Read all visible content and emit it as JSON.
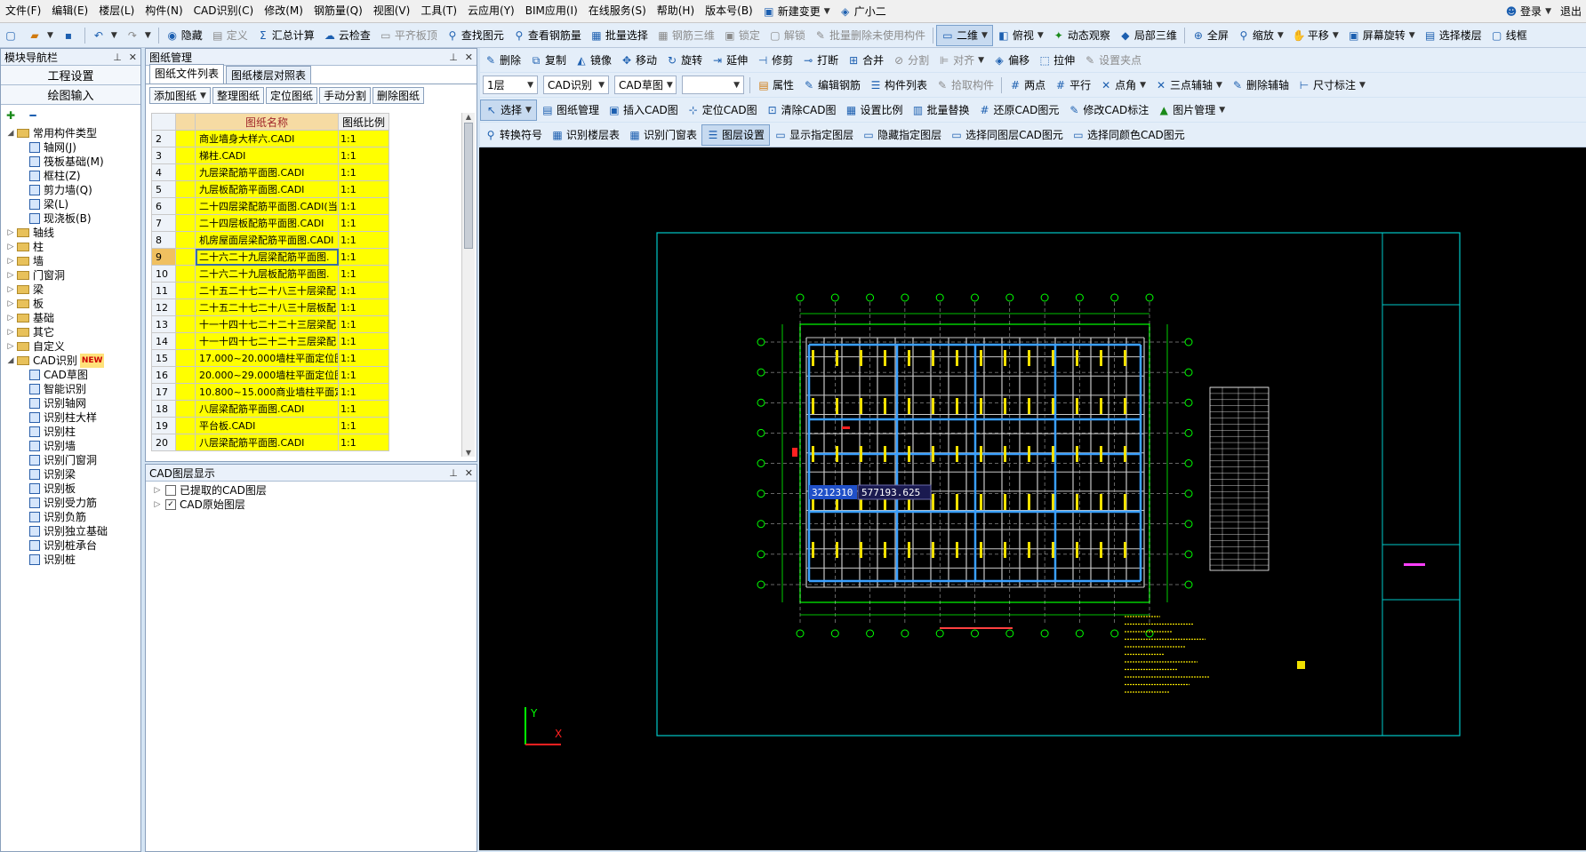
{
  "menubar": {
    "items": [
      "文件(F)",
      "编辑(E)",
      "楼层(L)",
      "构件(N)",
      "CAD识别(C)",
      "修改(M)",
      "钢筋量(Q)",
      "视图(V)",
      "工具(T)",
      "云应用(Y)",
      "BIM应用(I)",
      "在线服务(S)",
      "帮助(H)",
      "版本号(B)"
    ],
    "new_change": "新建变更",
    "assistant": "广小二",
    "login": "登录",
    "exit": "退出"
  },
  "toolbar1": {
    "hide": "隐藏",
    "define": "定义",
    "summary": "汇总计算",
    "cloud_check": "云检查",
    "flat_top": "平齐板顶",
    "find": "查找图元",
    "view_rebar": "查看钢筋量",
    "batch_select": "批量选择",
    "rebar_3d": "钢筋三维",
    "lock": "锁定",
    "unlock": "解锁",
    "batch_delete": "批量删除未使用构件",
    "view_2d": "二维",
    "top_view": "俯视",
    "dynamic": "动态观察",
    "local_3d": "局部三维",
    "fullscreen": "全屏",
    "zoom": "缩放",
    "pan": "平移",
    "rotate_screen": "屏幕旋转",
    "select_floor": "选择楼层",
    "wireframe": "线框"
  },
  "toolbar2": {
    "delete": "删除",
    "copy": "复制",
    "mirror": "镜像",
    "move": "移动",
    "rotate": "旋转",
    "extend": "延伸",
    "trim": "修剪",
    "break": "打断",
    "merge": "合并",
    "split": "分割",
    "align": "对齐",
    "offset": "偏移",
    "stretch": "拉伸",
    "set_grip": "设置夹点"
  },
  "toolbar3": {
    "floor": "1层",
    "cad_identify": "CAD识别",
    "cad_sketch": "CAD草图",
    "property": "属性",
    "edit_rebar": "编辑钢筋",
    "component_list": "构件列表",
    "pick": "拾取构件",
    "two_point": "两点",
    "parallel": "平行",
    "point_angle": "点角",
    "three_point_aux": "三点辅轴",
    "delete_aux": "删除辅轴",
    "dimension": "尺寸标注"
  },
  "toolbar4": {
    "select": "选择",
    "drawing_mgr": "图纸管理",
    "insert_cad": "插入CAD图",
    "locate_cad": "定位CAD图",
    "clear_cad": "清除CAD图",
    "set_scale": "设置比例",
    "batch_replace": "批量替换",
    "restore_cad": "还原CAD图元",
    "modify_cad_label": "修改CAD标注",
    "image_mgr": "图片管理"
  },
  "toolbar5": {
    "convert_symbol": "转换符号",
    "identify_floor_table": "识别楼层表",
    "identify_door_table": "识别门窗表",
    "layer_setting": "图层设置",
    "show_layer": "显示指定图层",
    "hide_layer": "隐藏指定图层",
    "same_layer": "选择同图层CAD图元",
    "same_color": "选择同颜色CAD图元"
  },
  "nav": {
    "title": "模块导航栏",
    "project_settings": "工程设置",
    "drawing_input": "绘图输入",
    "tree": [
      {
        "label": "常用构件类型",
        "level": 0,
        "type": "folder",
        "expanded": true
      },
      {
        "label": "轴网(J)",
        "level": 1,
        "type": "comp"
      },
      {
        "label": "筏板基础(M)",
        "level": 1,
        "type": "comp"
      },
      {
        "label": "框柱(Z)",
        "level": 1,
        "type": "comp"
      },
      {
        "label": "剪力墙(Q)",
        "level": 1,
        "type": "comp"
      },
      {
        "label": "梁(L)",
        "level": 1,
        "type": "comp"
      },
      {
        "label": "现浇板(B)",
        "level": 1,
        "type": "comp"
      },
      {
        "label": "轴线",
        "level": 0,
        "type": "folder"
      },
      {
        "label": "柱",
        "level": 0,
        "type": "folder"
      },
      {
        "label": "墙",
        "level": 0,
        "type": "folder"
      },
      {
        "label": "门窗洞",
        "level": 0,
        "type": "folder"
      },
      {
        "label": "梁",
        "level": 0,
        "type": "folder"
      },
      {
        "label": "板",
        "level": 0,
        "type": "folder"
      },
      {
        "label": "基础",
        "level": 0,
        "type": "folder"
      },
      {
        "label": "其它",
        "level": 0,
        "type": "folder"
      },
      {
        "label": "自定义",
        "level": 0,
        "type": "folder"
      },
      {
        "label": "CAD识别",
        "level": 0,
        "type": "folder",
        "expanded": true,
        "new": "NEW"
      },
      {
        "label": "CAD草图",
        "level": 1,
        "type": "comp"
      },
      {
        "label": "智能识别",
        "level": 1,
        "type": "comp"
      },
      {
        "label": "识别轴网",
        "level": 1,
        "type": "comp"
      },
      {
        "label": "识别柱大样",
        "level": 1,
        "type": "comp"
      },
      {
        "label": "识别柱",
        "level": 1,
        "type": "comp"
      },
      {
        "label": "识别墙",
        "level": 1,
        "type": "comp"
      },
      {
        "label": "识别门窗洞",
        "level": 1,
        "type": "comp"
      },
      {
        "label": "识别梁",
        "level": 1,
        "type": "comp"
      },
      {
        "label": "识别板",
        "level": 1,
        "type": "comp"
      },
      {
        "label": "识别受力筋",
        "level": 1,
        "type": "comp"
      },
      {
        "label": "识别负筋",
        "level": 1,
        "type": "comp"
      },
      {
        "label": "识别独立基础",
        "level": 1,
        "type": "comp"
      },
      {
        "label": "识别桩承台",
        "level": 1,
        "type": "comp"
      },
      {
        "label": "识别桩",
        "level": 1,
        "type": "comp"
      }
    ]
  },
  "drawing_mgr": {
    "title": "图纸管理",
    "tabs": [
      "图纸文件列表",
      "图纸楼层对照表"
    ],
    "buttons": [
      "添加图纸",
      "整理图纸",
      "定位图纸",
      "手动分割",
      "删除图纸"
    ],
    "col_name": "图纸名称",
    "col_scale": "图纸比例",
    "rows": [
      {
        "n": "2",
        "name": "商业墙身大样六.CADI",
        "scale": "1:1"
      },
      {
        "n": "3",
        "name": "梯柱.CADI",
        "scale": "1:1"
      },
      {
        "n": "4",
        "name": "九层梁配筋平面图.CADI",
        "scale": "1:1"
      },
      {
        "n": "5",
        "name": "九层板配筋平面图.CADI",
        "scale": "1:1"
      },
      {
        "n": "6",
        "name": "二十四层梁配筋平面图.CADI(当",
        "scale": "1:1"
      },
      {
        "n": "7",
        "name": "二十四层板配筋平面图.CADI",
        "scale": "1:1"
      },
      {
        "n": "8",
        "name": "机房屋面层梁配筋平面图.CADI",
        "scale": "1:1"
      },
      {
        "n": "9",
        "name": "二十六二十九层梁配筋平面图.",
        "scale": "1:1",
        "selected": true
      },
      {
        "n": "10",
        "name": "二十六二十九层板配筋平面图.",
        "scale": "1:1"
      },
      {
        "n": "11",
        "name": "二十五二十七二十八三十层梁配",
        "scale": "1:1"
      },
      {
        "n": "12",
        "name": "二十五二十七二十八三十层板配",
        "scale": "1:1"
      },
      {
        "n": "13",
        "name": "十一十四十七二十二十三层梁配",
        "scale": "1:1"
      },
      {
        "n": "14",
        "name": "十一十四十七二十二十三层梁配",
        "scale": "1:1"
      },
      {
        "n": "15",
        "name": "17.000~20.000墙柱平面定位图.",
        "scale": "1:1"
      },
      {
        "n": "16",
        "name": "20.000~29.000墙柱平面定位图.",
        "scale": "1:1"
      },
      {
        "n": "17",
        "name": "10.800~15.000商业墙柱平面定",
        "scale": "1:1"
      },
      {
        "n": "18",
        "name": "八层梁配筋平面图.CADI",
        "scale": "1:1"
      },
      {
        "n": "19",
        "name": "平台板.CADI",
        "scale": "1:1"
      },
      {
        "n": "20",
        "name": "八层梁配筋平面图.CADI",
        "scale": "1:1"
      }
    ]
  },
  "layer_panel": {
    "title": "CAD图层显示",
    "items": [
      {
        "label": "已提取的CAD图层",
        "checked": false
      },
      {
        "label": "CAD原始图层",
        "checked": true
      }
    ]
  },
  "cad": {
    "coord_x": "3212310",
    "coord_y": "577193.625",
    "axis_y": "Y",
    "axis_x": "X"
  }
}
